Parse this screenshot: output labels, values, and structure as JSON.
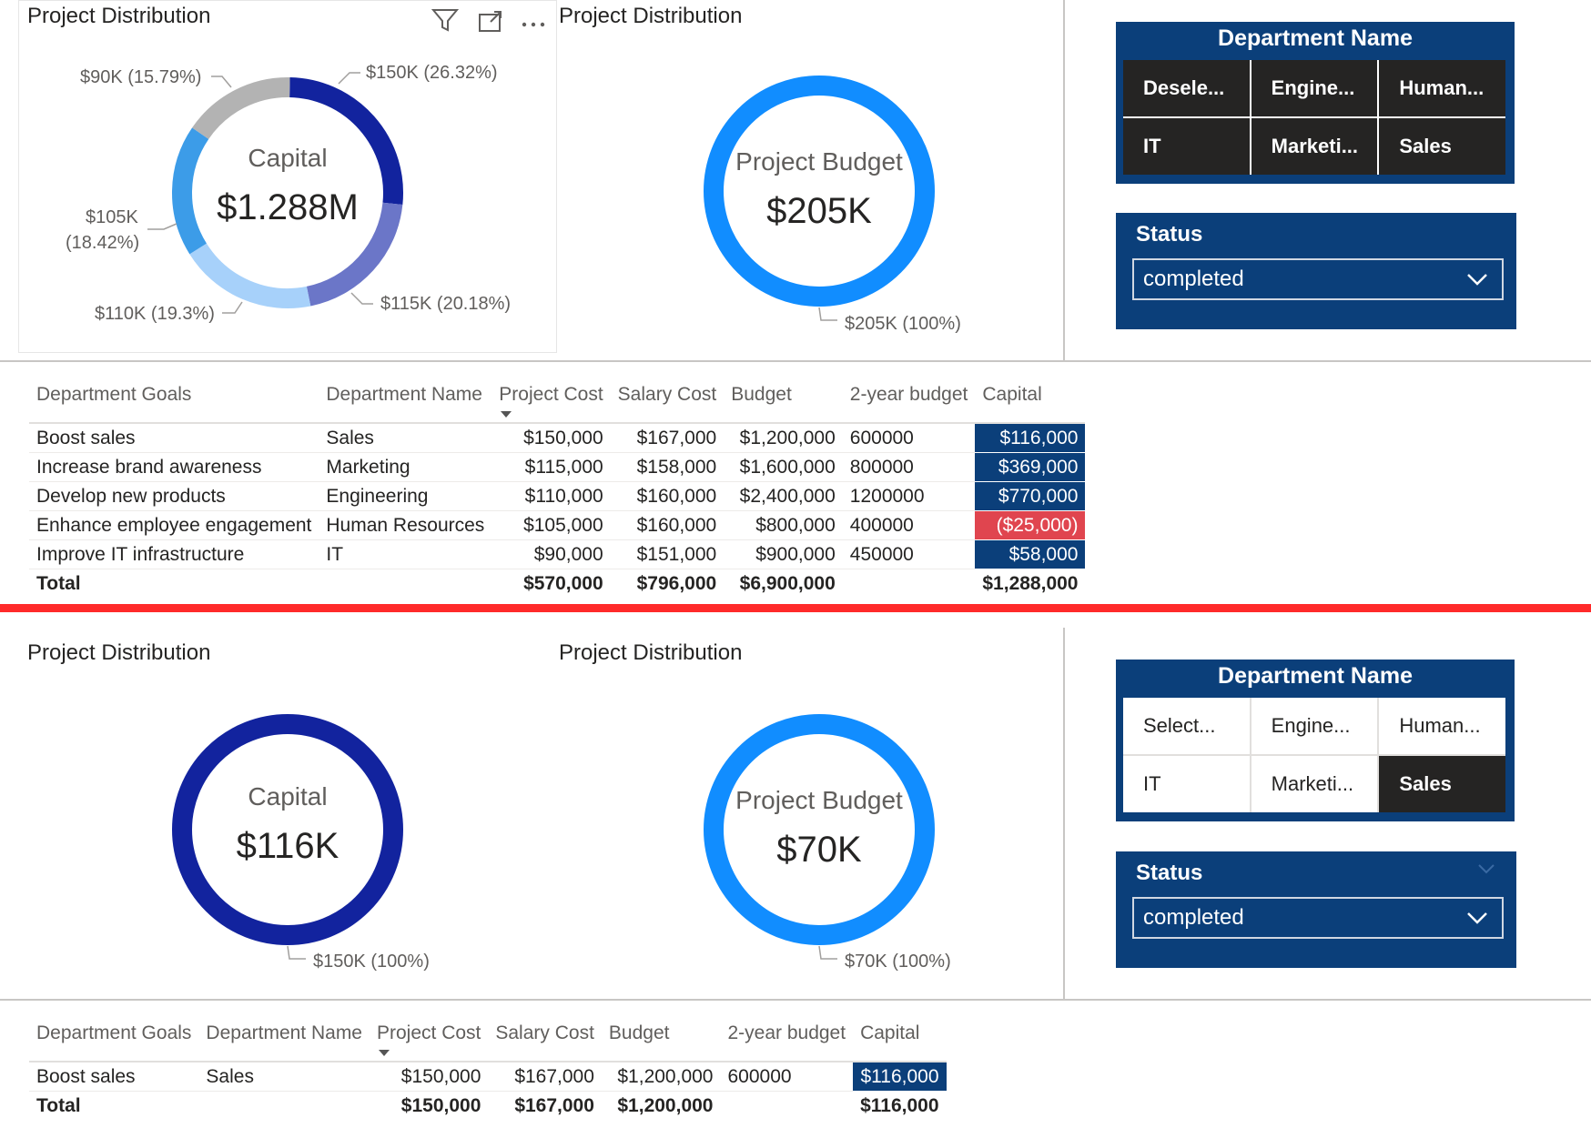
{
  "top": {
    "donut1": {
      "title": "Project Distribution",
      "center_label": "Capital",
      "center_value": "$1.288M",
      "labels": [
        "$150K (26.32%)",
        "$115K (20.18%)",
        "$110K (19.3%)",
        "$105K",
        "(18.42%)",
        "$90K (15.79%)"
      ]
    },
    "donut2": {
      "title": "Project Distribution",
      "center_label": "Project Budget",
      "center_value": "$205K",
      "label": "$205K (100%)"
    },
    "toolbar_icons": [
      "filter-icon",
      "focus-mode-icon",
      "more-options-icon"
    ],
    "dept_slicer": {
      "title": "Department Name",
      "tiles": [
        "Desele...",
        "Engine...",
        "Human...",
        "IT",
        "Marketi...",
        "Sales"
      ],
      "selected": [
        true,
        true,
        true,
        true,
        true,
        true
      ]
    },
    "status_slicer": {
      "label": "Status",
      "value": "completed"
    },
    "table": {
      "headers": [
        "Department Goals",
        "Department Name",
        "Project Cost",
        "Salary Cost",
        "Budget",
        "2-year budget",
        "Capital"
      ],
      "rows": [
        [
          "Boost sales",
          "Sales",
          "$150,000",
          "$167,000",
          "$1,200,000",
          "600000",
          "$116,000"
        ],
        [
          "Increase brand awareness",
          "Marketing",
          "$115,000",
          "$158,000",
          "$1,600,000",
          "800000",
          "$369,000"
        ],
        [
          "Develop new products",
          "Engineering",
          "$110,000",
          "$160,000",
          "$2,400,000",
          "1200000",
          "$770,000"
        ],
        [
          "Enhance employee engagement",
          "Human Resources",
          "$105,000",
          "$160,000",
          "$800,000",
          "400000",
          "($25,000)"
        ],
        [
          "Improve IT infrastructure",
          "IT",
          "$90,000",
          "$151,000",
          "$900,000",
          "450000",
          "$58,000"
        ]
      ],
      "total": [
        "Total",
        "",
        "$570,000",
        "$796,000",
        "$6,900,000",
        "",
        "$1,288,000"
      ]
    }
  },
  "bottom": {
    "donut1": {
      "title": "Project Distribution",
      "center_label": "Capital",
      "center_value": "$116K",
      "label": "$150K (100%)"
    },
    "donut2": {
      "title": "Project Distribution",
      "center_label": "Project Budget",
      "center_value": "$70K",
      "label": "$70K (100%)"
    },
    "dept_slicer": {
      "title": "Department Name",
      "tiles": [
        "Select...",
        "Engine...",
        "Human...",
        "IT",
        "Marketi...",
        "Sales"
      ],
      "selected": [
        false,
        false,
        false,
        false,
        false,
        true
      ]
    },
    "status_slicer": {
      "label": "Status",
      "value": "completed"
    },
    "table": {
      "headers": [
        "Department Goals",
        "Department Name",
        "Project Cost",
        "Salary Cost",
        "Budget",
        "2-year budget",
        "Capital"
      ],
      "rows": [
        [
          "Boost sales",
          "Sales",
          "$150,000",
          "$167,000",
          "$1,200,000",
          "600000",
          "$116,000"
        ]
      ],
      "total": [
        "Total",
        "",
        "$150,000",
        "$167,000",
        "$1,200,000",
        "",
        "$116,000"
      ]
    }
  },
  "chart_data": [
    {
      "type": "pie",
      "title": "Project Distribution",
      "categories": [
        "Sales",
        "Marketing",
        "Engineering",
        "Human Resources",
        "IT"
      ],
      "values": [
        150000,
        115000,
        110000,
        105000,
        90000
      ],
      "percentages": [
        26.32,
        20.18,
        19.3,
        18.42,
        15.79
      ],
      "colors": [
        "#12239e",
        "#6b76c8",
        "#a7d1fa",
        "#3c9ce8",
        "#b3b3b3"
      ],
      "center_label": "Capital",
      "center_value": "$1.288M"
    },
    {
      "type": "pie",
      "title": "Project Distribution",
      "categories": [
        "Project Budget"
      ],
      "values": [
        205000
      ],
      "percentages": [
        100
      ],
      "colors": [
        "#118dff"
      ],
      "center_label": "Project Budget",
      "center_value": "$205K"
    },
    {
      "type": "pie",
      "title": "Project Distribution",
      "categories": [
        "Sales"
      ],
      "values": [
        150000
      ],
      "percentages": [
        100
      ],
      "colors": [
        "#12239e"
      ],
      "center_label": "Capital",
      "center_value": "$116K"
    },
    {
      "type": "pie",
      "title": "Project Distribution",
      "categories": [
        "Project Budget"
      ],
      "values": [
        70000
      ],
      "percentages": [
        100
      ],
      "colors": [
        "#118dff"
      ],
      "center_label": "Project Budget",
      "center_value": "$70K"
    }
  ]
}
